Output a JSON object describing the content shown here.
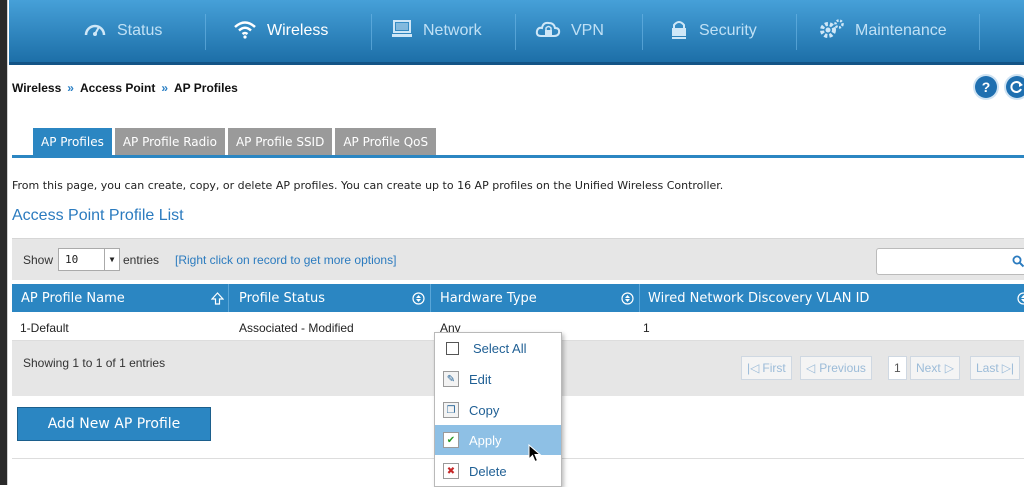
{
  "nav": {
    "items": [
      {
        "label": "Status",
        "icon": "gauge-icon"
      },
      {
        "label": "Wireless",
        "icon": "wifi-icon"
      },
      {
        "label": "Network",
        "icon": "monitor-icon"
      },
      {
        "label": "VPN",
        "icon": "cloud-lock-icon"
      },
      {
        "label": "Security",
        "icon": "lock-icon"
      },
      {
        "label": "Maintenance",
        "icon": "gears-icon"
      }
    ],
    "active": "Wireless"
  },
  "breadcrumb": {
    "part1": "Wireless",
    "sep": "»",
    "part2": "Access Point",
    "part3": "AP Profiles"
  },
  "help": {
    "label": "?"
  },
  "tabs": [
    {
      "label": "AP Profiles"
    },
    {
      "label": "AP Profile Radio"
    },
    {
      "label": "AP Profile SSID"
    },
    {
      "label": "AP Profile QoS"
    }
  ],
  "description": "From this page, you can create, copy, or delete AP profiles. You can create up to 16 AP profiles on the Unified Wireless Controller.",
  "list_title": "Access Point Profile List",
  "toolbar": {
    "show_label": "Show",
    "entries_value": "10",
    "entries_label": "entries",
    "right_click_hint": "[Right click on record to get more options]"
  },
  "table": {
    "columns": [
      "AP Profile Name",
      "Profile Status",
      "Hardware Type",
      "Wired Network Discovery VLAN ID"
    ],
    "rows": [
      [
        "1-Default",
        "Associated - Modified",
        "Any",
        "1"
      ]
    ]
  },
  "footer": {
    "showing": "Showing 1 to 1 of 1 entries",
    "first": "First",
    "previous": "Previous",
    "page": "1",
    "next": "Next",
    "last": "Last"
  },
  "add_button": "Add New AP Profile",
  "context_menu": {
    "select_all": "Select All",
    "edit": "Edit",
    "copy": "Copy",
    "apply": "Apply",
    "delete": "Delete",
    "hovered": "Apply"
  },
  "colors": {
    "nav_top": "#46a0d8",
    "accent": "#2b86c2",
    "title_blue": "#2b7bbf",
    "hover": "#8ec0e5"
  }
}
